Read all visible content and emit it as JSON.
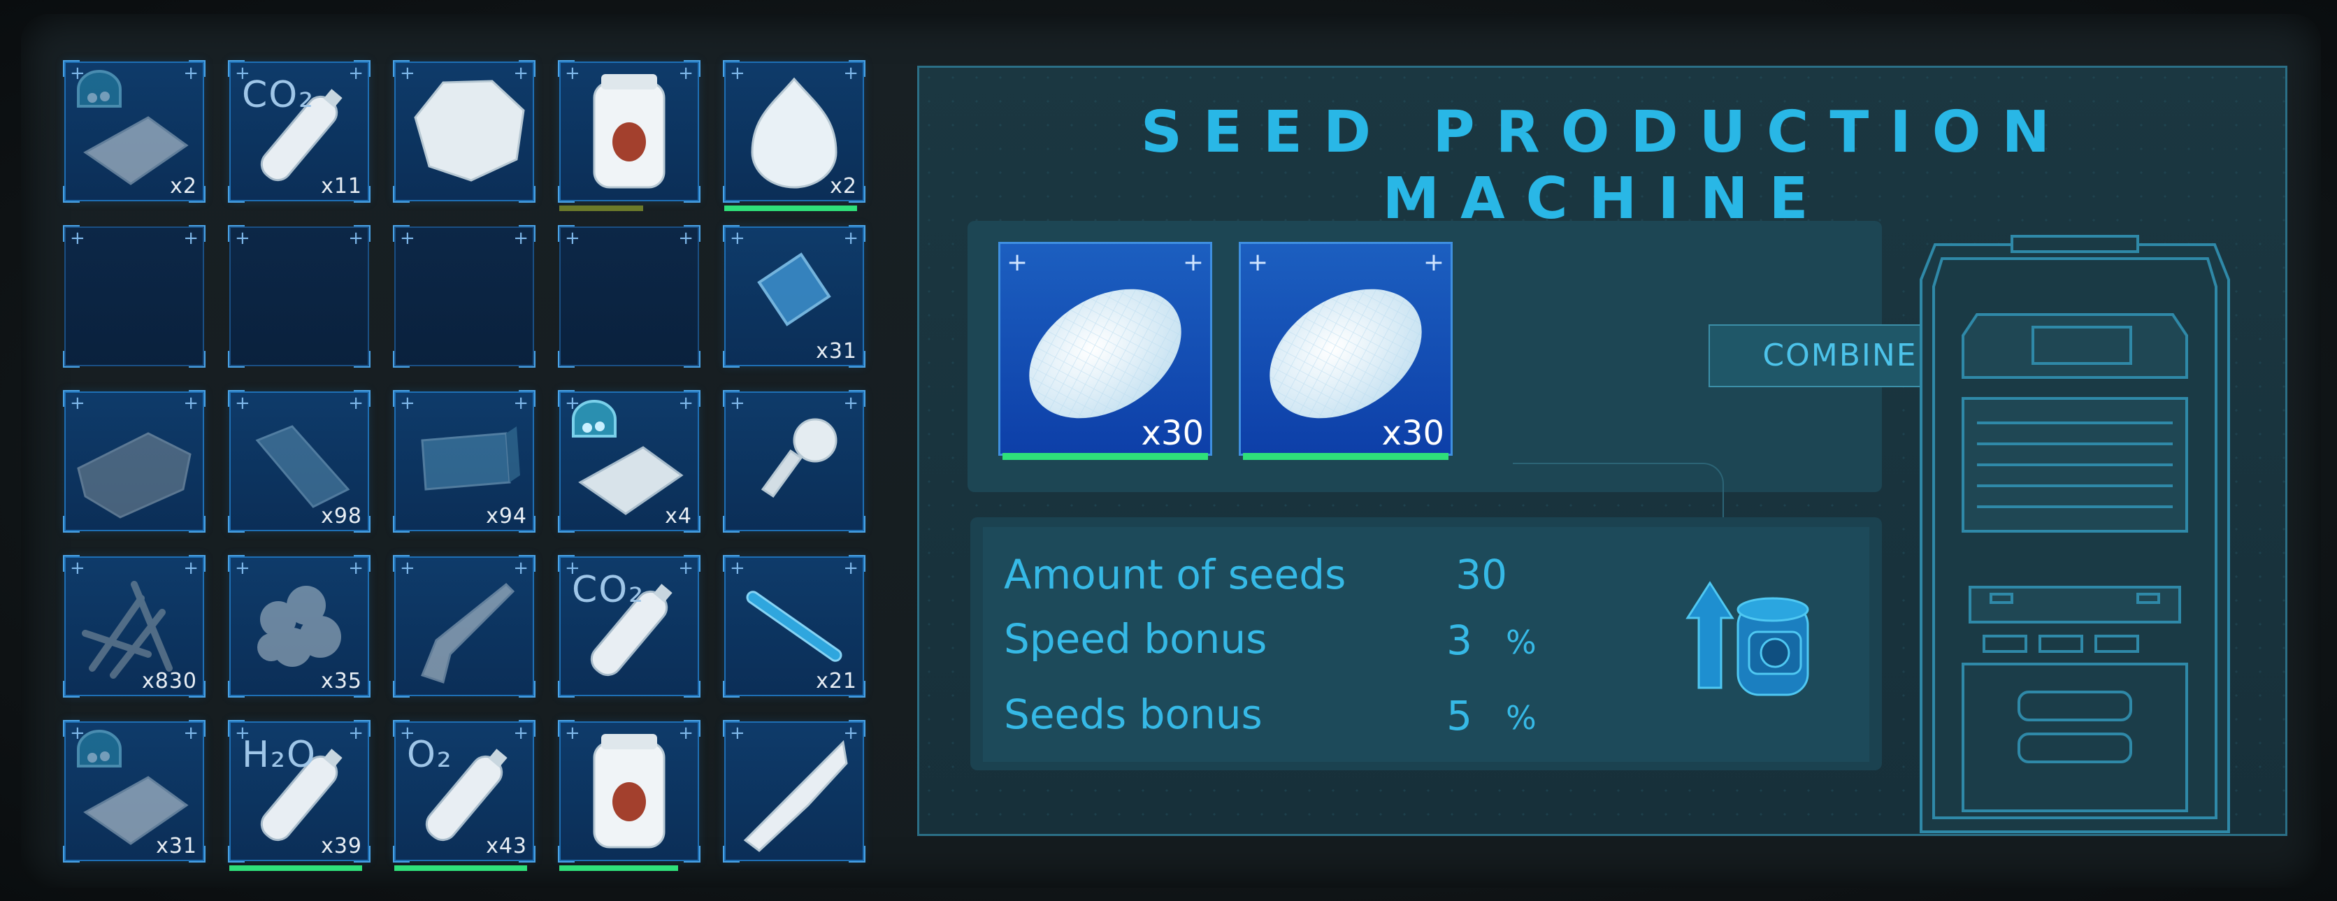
{
  "inventory": {
    "slots": [
      {
        "row": 0,
        "col": 0,
        "icon": "basket-bag-icon",
        "qty": "x2",
        "label": "",
        "bar": null,
        "dim": true
      },
      {
        "row": 0,
        "col": 1,
        "icon": "gas-bottle-icon",
        "qty": "x11",
        "label": "CO₂",
        "bar": null,
        "dim": false
      },
      {
        "row": 0,
        "col": 2,
        "icon": "rock-ore-icon",
        "qty": "",
        "label": "",
        "bar": null,
        "dim": false
      },
      {
        "row": 0,
        "col": 3,
        "icon": "food-jar-icon",
        "qty": "",
        "label": "",
        "bar": {
          "color": "#6b7a2a",
          "fraction": 0.6
        },
        "dim": false
      },
      {
        "row": 0,
        "col": 4,
        "icon": "seed-bulb-icon",
        "qty": "x2",
        "label": "",
        "bar": {
          "color": "#2fe07a",
          "fraction": 0.95
        },
        "dim": false
      },
      {
        "row": 1,
        "col": 0,
        "icon": "",
        "qty": "",
        "label": "",
        "bar": null,
        "dim": false,
        "empty": true
      },
      {
        "row": 1,
        "col": 1,
        "icon": "",
        "qty": "",
        "label": "",
        "bar": null,
        "dim": false,
        "empty": true
      },
      {
        "row": 1,
        "col": 2,
        "icon": "",
        "qty": "",
        "label": "",
        "bar": null,
        "dim": false,
        "empty": true
      },
      {
        "row": 1,
        "col": 3,
        "icon": "",
        "qty": "",
        "label": "",
        "bar": null,
        "dim": false,
        "empty": true
      },
      {
        "row": 1,
        "col": 4,
        "icon": "glass-pane-icon",
        "qty": "x31",
        "label": "",
        "bar": null,
        "dim": false
      },
      {
        "row": 2,
        "col": 0,
        "icon": "metal-sheet-icon",
        "qty": "",
        "label": "",
        "bar": null,
        "dim": true
      },
      {
        "row": 2,
        "col": 1,
        "icon": "panel-plate-icon",
        "qty": "x98",
        "label": "",
        "bar": null,
        "dim": true
      },
      {
        "row": 2,
        "col": 2,
        "icon": "block-brick-icon",
        "qty": "x94",
        "label": "",
        "bar": null,
        "dim": true
      },
      {
        "row": 2,
        "col": 3,
        "icon": "basket-bag-icon",
        "qty": "x4",
        "label": "",
        "bar": null,
        "dim": false
      },
      {
        "row": 2,
        "col": 4,
        "icon": "sprinkler-icon",
        "qty": "",
        "label": "",
        "bar": null,
        "dim": false
      },
      {
        "row": 3,
        "col": 0,
        "icon": "scrap-parts-icon",
        "qty": "x830",
        "label": "",
        "bar": null,
        "dim": true
      },
      {
        "row": 3,
        "col": 1,
        "icon": "fiber-clump-icon",
        "qty": "x35",
        "label": "",
        "bar": null,
        "dim": true
      },
      {
        "row": 3,
        "col": 2,
        "icon": "drill-tool-icon",
        "qty": "",
        "label": "",
        "bar": null,
        "dim": true
      },
      {
        "row": 3,
        "col": 3,
        "icon": "gas-bottle-icon",
        "qty": "",
        "label": "CO₂",
        "bar": null,
        "dim": false
      },
      {
        "row": 3,
        "col": 4,
        "icon": "rod-icon",
        "qty": "x21",
        "label": "",
        "bar": null,
        "dim": false
      },
      {
        "row": 4,
        "col": 0,
        "icon": "basket-bag-icon",
        "qty": "x31",
        "label": "",
        "bar": null,
        "dim": true
      },
      {
        "row": 4,
        "col": 1,
        "icon": "gas-bottle-icon",
        "qty": "x39",
        "label": "H₂O",
        "bar": {
          "color": "#2fe07a",
          "fraction": 0.95
        },
        "dim": false
      },
      {
        "row": 4,
        "col": 2,
        "icon": "gas-bottle-icon",
        "qty": "x43",
        "label": "O₂",
        "bar": {
          "color": "#2fe07a",
          "fraction": 0.95
        },
        "dim": false
      },
      {
        "row": 4,
        "col": 3,
        "icon": "food-jar-icon",
        "qty": "",
        "label": "",
        "bar": {
          "color": "#2fe07a",
          "fraction": 0.85
        },
        "dim": false
      },
      {
        "row": 4,
        "col": 4,
        "icon": "blade-tool-icon",
        "qty": "",
        "label": "",
        "bar": null,
        "dim": false
      }
    ]
  },
  "machine": {
    "title": "SEED PRODUCTION MACHINE",
    "input_slots": [
      {
        "icon": "seed-icon",
        "qty": "x30",
        "bar_color": "#2fe07a"
      },
      {
        "icon": "seed-icon",
        "qty": "x30",
        "bar_color": "#2fe07a"
      }
    ],
    "combine_label": "COMBINE",
    "stats": [
      {
        "label": "Amount of seeds",
        "value": "30",
        "unit": ""
      },
      {
        "label": "Speed bonus",
        "value": "3",
        "unit": "%"
      },
      {
        "label": "Seeds bonus",
        "value": "5",
        "unit": "%"
      }
    ],
    "bonus_icon": "upgrade-canister-icon",
    "machine_icon": "seed-machine-icon"
  },
  "colors": {
    "accent": "#29b7e6",
    "slot_blue": "#0e3b6a",
    "bar_green": "#2fe07a"
  }
}
